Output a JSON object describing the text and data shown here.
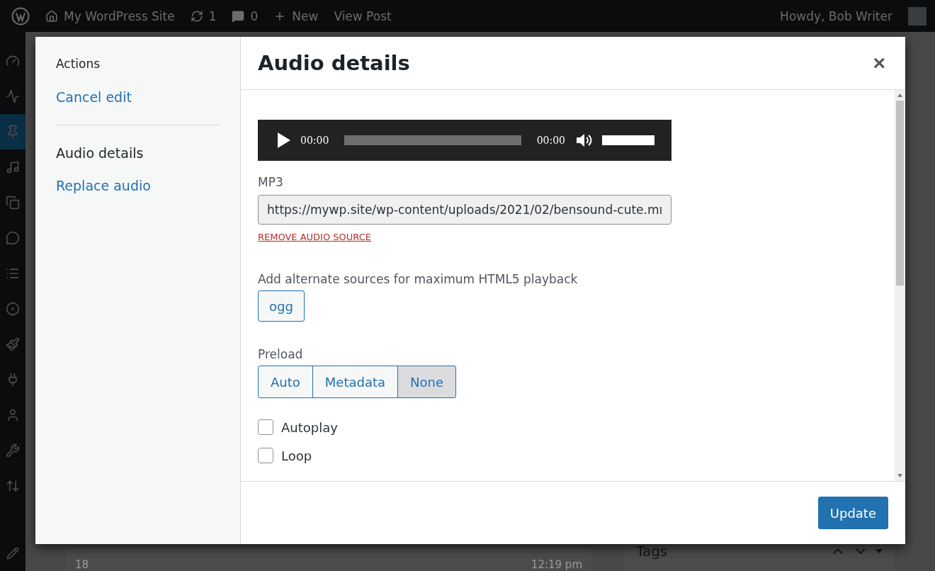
{
  "admin_bar": {
    "site": "My WordPress Site",
    "updates": "1",
    "comments": "0",
    "new": "New",
    "view_post": "View Post",
    "greeting": "Howdy, Bob Writer"
  },
  "admin_menu": [
    {
      "selected": false
    },
    {
      "selected": false
    },
    {
      "selected": true
    },
    {
      "selected": false
    },
    {
      "selected": false
    },
    {
      "selected": false
    },
    {
      "selected": false
    },
    {
      "selected": false
    },
    {
      "selected": false
    },
    {
      "selected": false
    },
    {
      "selected": false
    },
    {
      "selected": false
    },
    {
      "selected": false
    }
  ],
  "background": {
    "word_count": "18",
    "draft_time": "12:19 pm",
    "tags": "Tags"
  },
  "modal": {
    "sidebar": {
      "heading": "Actions",
      "links": [
        {
          "label": "Cancel edit",
          "selected": false
        }
      ],
      "sections": [
        {
          "label": "Audio details",
          "selected": true
        },
        {
          "label": "Replace audio",
          "selected": false
        }
      ]
    },
    "title": "Audio details",
    "close": "×",
    "player": {
      "current_time": "00:00",
      "duration": "00:00",
      "volume": {
        "level": 1
      }
    },
    "source": {
      "label": "MP3",
      "value": "https://mywp.site/wp-content/uploads/2021/02/bensound-cute.mı",
      "remove": "REMOVE AUDIO SOURCE"
    },
    "alternate": {
      "label": "Add alternate sources for maximum HTML5 playback",
      "buttons": [
        "ogg"
      ]
    },
    "preload": {
      "label": "Preload",
      "options": [
        {
          "label": "Auto",
          "selected": false
        },
        {
          "label": "Metadata",
          "selected": false
        },
        {
          "label": "None",
          "selected": true
        }
      ]
    },
    "checkboxes": [
      {
        "label": "Autoplay",
        "checked": false
      },
      {
        "label": "Loop",
        "checked": false
      }
    ],
    "update_button": "Update"
  }
}
